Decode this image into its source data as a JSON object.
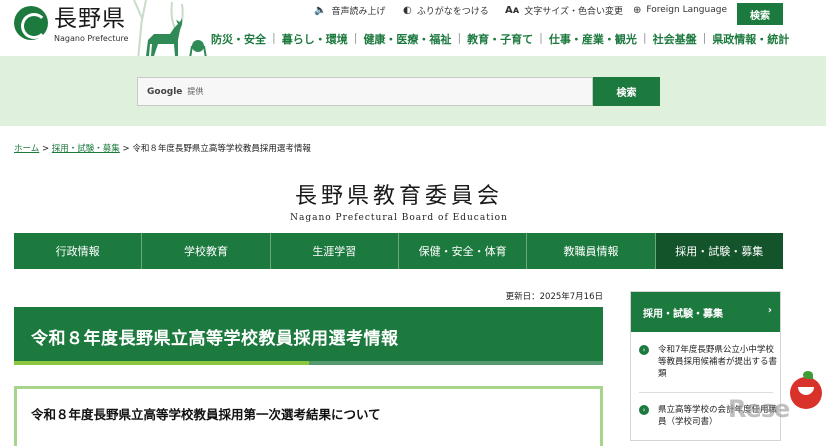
{
  "header": {
    "logo_title": "長野県",
    "logo_subtitle": "Nagano Prefecture",
    "utility": [
      {
        "icon": "speaker-icon",
        "label": "音声読み上げ"
      },
      {
        "icon": "furigana-icon",
        "label": "ふりがなをつける"
      },
      {
        "icon": "text-size-icon",
        "label": "文字サイズ・色合い変更"
      },
      {
        "icon": "globe-icon",
        "label": "Foreign Language"
      }
    ],
    "search_button": "検索",
    "nav": [
      "防災・安全",
      "暮らし・環境",
      "健康・医療・福祉",
      "教育・子育て",
      "仕事・産業・観光",
      "社会基盤",
      "県政情報・統計"
    ]
  },
  "search": {
    "provider": "Google",
    "provider_suffix": "提供",
    "button": "検索"
  },
  "breadcrumb": {
    "home": "ホーム",
    "parent": "採用・試験・募集",
    "current": "令和８年度長野県立高等学校教員採用選考情報",
    "separator": ">"
  },
  "board": {
    "title": "長野県教育委員会",
    "subtitle": "Nagano Prefectural Board of Education"
  },
  "board_nav": [
    "行政情報",
    "学校教育",
    "生涯学習",
    "保健・安全・体育",
    "教職員情報",
    "採用・試験・募集"
  ],
  "main": {
    "updated": "更新日：2025年7月16日",
    "page_title": "令和８年度長野県立高等学校教員採用選考情報",
    "section_title": "令和８年度長野県立高等学校教員採用第一次選考結果について"
  },
  "side": {
    "heading": "採用・試験・募集",
    "items": [
      "令和7年度長野県公立小中学校等教員採用候補者が提出する書類",
      "県立高等学校の会計年度任用職員（学校司書）"
    ]
  },
  "colors": {
    "brand_green": "#1d7a3f",
    "band_green": "#dff1dc",
    "accent_lime": "#8cc63f"
  }
}
